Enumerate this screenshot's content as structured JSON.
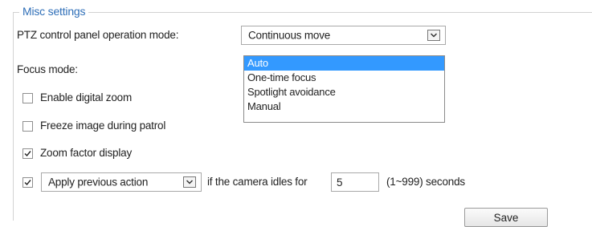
{
  "section": {
    "legend": "Misc settings"
  },
  "ptz": {
    "label": "PTZ control panel operation mode:",
    "selected": "Continuous move"
  },
  "focus": {
    "label": "Focus mode:",
    "options": [
      "Auto",
      "One-time focus",
      "Spotlight avoidance",
      "Manual"
    ],
    "selected_index": 0
  },
  "options": {
    "digital_zoom": {
      "label": "Enable digital zoom",
      "checked": false
    },
    "freeze_image": {
      "label": "Freeze image during patrol",
      "checked": false
    },
    "zoom_factor": {
      "label": "Zoom factor display",
      "checked": true
    }
  },
  "idle_action": {
    "checked": true,
    "selected": "Apply previous action",
    "text_before": "if the camera idles for",
    "value": "5",
    "range_text": "(1~999) seconds"
  },
  "buttons": {
    "save": "Save"
  },
  "colors": {
    "legend": "#2f6fb8",
    "selection": "#3399ff"
  }
}
